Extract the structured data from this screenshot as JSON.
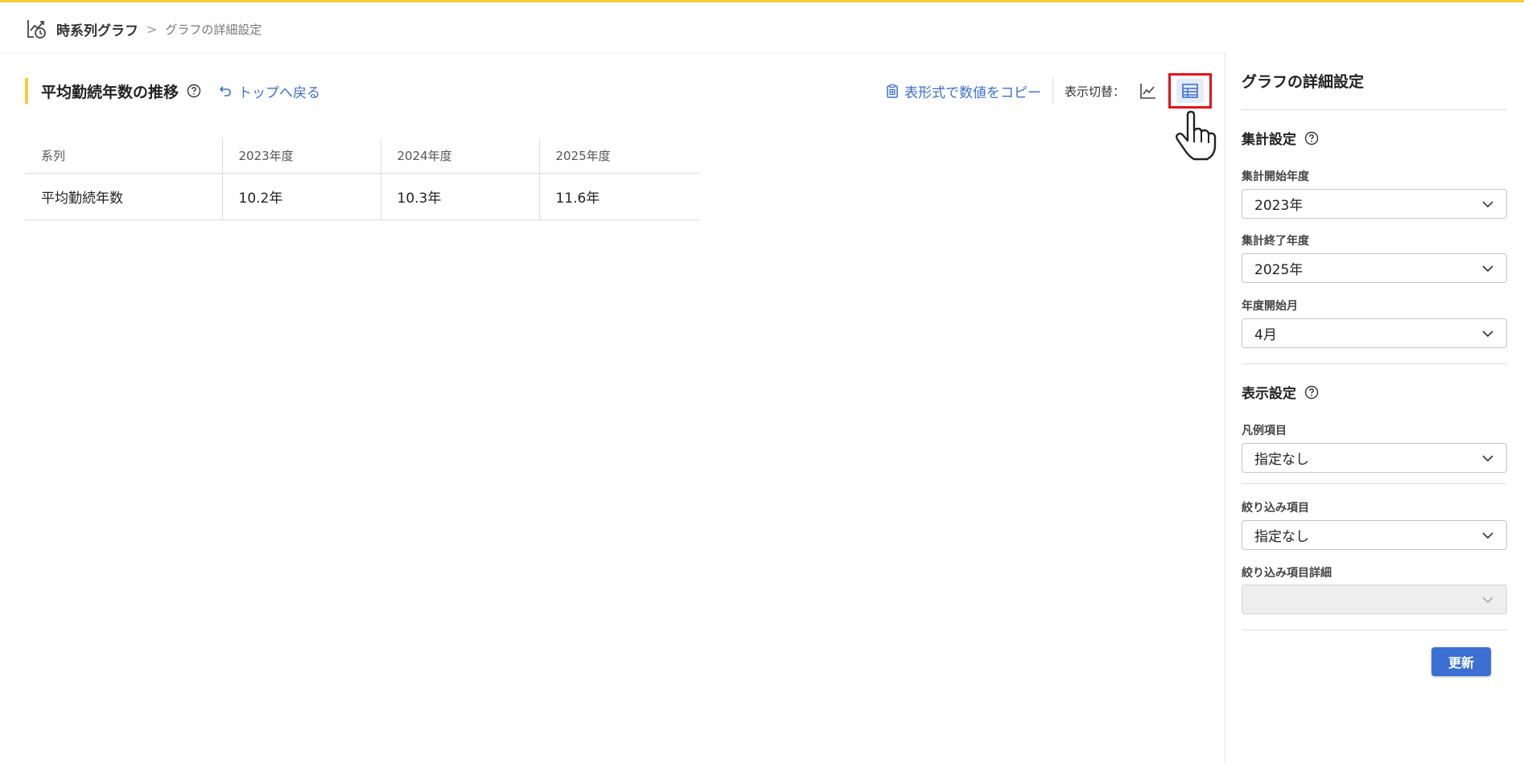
{
  "breadcrumb": {
    "app_title": "時系列グラフ",
    "separator": ">",
    "current": "グラフの詳細設定"
  },
  "main": {
    "title": "平均勤続年数の推移",
    "back_link": "トップへ戻る",
    "copy_link": "表形式で数値をコピー",
    "switch_label": "表示切替：",
    "active_view": "table"
  },
  "table": {
    "headers": [
      "系列",
      "2023年度",
      "2024年度",
      "2025年度"
    ],
    "rows": [
      [
        "平均勤続年数",
        "10.2年",
        "10.3年",
        "11.6年"
      ]
    ]
  },
  "panel": {
    "title": "グラフの詳細設定",
    "aggregation_section": "集計設定",
    "start_year_label": "集計開始年度",
    "start_year_value": "2023年",
    "end_year_label": "集計終了年度",
    "end_year_value": "2025年",
    "fiscal_month_label": "年度開始月",
    "fiscal_month_value": "4月",
    "display_section": "表示設定",
    "legend_label": "凡例項目",
    "legend_value": "指定なし",
    "filter_label": "絞り込み項目",
    "filter_value": "指定なし",
    "filter_detail_label": "絞り込み項目詳細",
    "filter_detail_value": "",
    "update_button": "更新"
  },
  "colors": {
    "accent_yellow": "#f2cf3a",
    "link_blue": "#3d6fd0",
    "button_blue": "#3c6fd2",
    "highlight_red": "#e3131b"
  }
}
